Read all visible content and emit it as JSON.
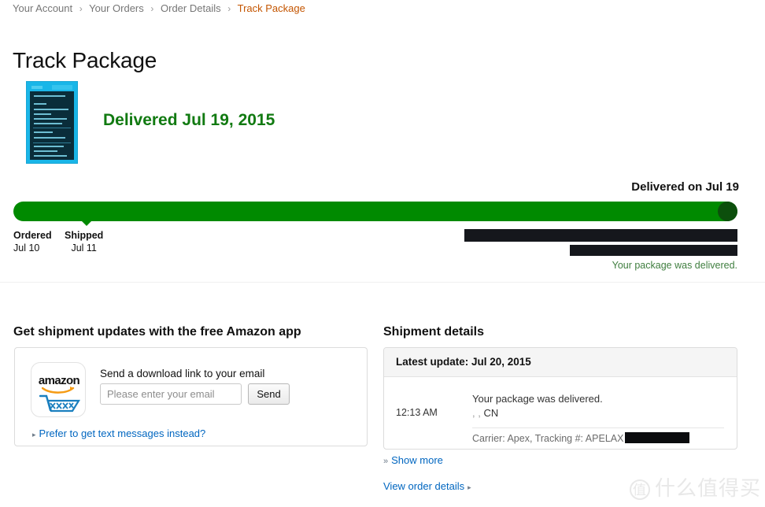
{
  "breadcrumb": {
    "separator": "›",
    "items": [
      {
        "label": "Your Account",
        "current": false
      },
      {
        "label": "Your Orders",
        "current": false
      },
      {
        "label": "Order Details",
        "current": false
      },
      {
        "label": "Track Package",
        "current": true
      }
    ]
  },
  "page": {
    "title": "Track Package"
  },
  "shipment": {
    "delivered_heading": "Delivered Jul 19, 2015",
    "delivered_on_label": "Delivered on Jul 19",
    "package_note": "Your package was delivered.",
    "milestones": [
      {
        "label": "Ordered",
        "date": "Jul 10"
      },
      {
        "label": "Shipped",
        "date": "Jul 11"
      }
    ],
    "progress_percent": 100,
    "redactions": [
      {
        "name": "address-line-1"
      },
      {
        "name": "address-line-2"
      }
    ]
  },
  "app_section": {
    "heading": "Get shipment updates with the free Amazon app",
    "logo_wordmark": "amazon",
    "download_label": "Send a download link to your email",
    "email_value": "",
    "email_placeholder": "Please enter your email",
    "send_label": "Send",
    "prefer_sms_label": "Prefer to get text messages instead?",
    "prefer_caret": "▸"
  },
  "details_section": {
    "heading": "Shipment details",
    "latest_update": "Latest update: Jul 20, 2015",
    "event": {
      "time": "12:13 AM",
      "message": "Your package was delivered.",
      "location_prefix": ", , ",
      "location": "CN",
      "carrier_line": "Carrier: Apex, Tracking #: APELAX"
    },
    "show_more_label": "Show more",
    "show_more_caret": "»",
    "view_order_label": "View order details",
    "view_order_caret": "▸"
  },
  "watermark": {
    "badge": "值",
    "text": "什么值得买"
  },
  "colors": {
    "accent_orange": "#c45500",
    "link_blue": "#0066c0",
    "delivered_green": "#117a11",
    "progress_green": "#008a00",
    "progress_dot": "#0c4f0c",
    "note_green": "#3f7e3f",
    "breadcrumb_grey": "#767676",
    "redaction_black": "#15171c"
  }
}
